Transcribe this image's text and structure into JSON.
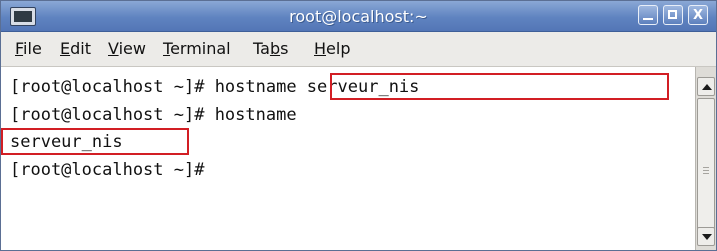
{
  "window": {
    "title": "root@localhost:~",
    "controls": {
      "minimize_icon": "minimize-icon",
      "maximize_icon": "maximize-icon",
      "close_label": "X"
    }
  },
  "menubar": {
    "items": [
      {
        "label_mnemonic": "F",
        "label_rest": "ile"
      },
      {
        "label_mnemonic": "E",
        "label_rest": "dit"
      },
      {
        "label_mnemonic": "V",
        "label_rest": "iew"
      },
      {
        "label_mnemonic": "T",
        "label_rest": "erminal"
      },
      {
        "label_pre": "Ta",
        "label_mnemonic": "b",
        "label_rest": "s"
      },
      {
        "label_mnemonic": "H",
        "label_rest": "elp"
      }
    ]
  },
  "terminal": {
    "lines": [
      "[root@localhost ~]# hostname serveur_nis",
      "[root@localhost ~]# hostname",
      "serveur_nis",
      "[root@localhost ~]#"
    ]
  },
  "colors": {
    "titlebar": "#5f83c0",
    "highlight_box": "#d21e24",
    "terminal_bg": "#ffffff"
  }
}
